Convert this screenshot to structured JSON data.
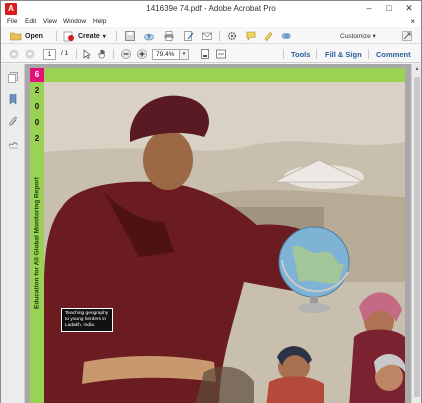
{
  "window": {
    "title": "141639e 74.pdf - Adobe Acrobat Pro",
    "app_icon_letter": "A",
    "controls": {
      "minimize": "–",
      "maximize": "□",
      "close": "✕"
    }
  },
  "menubar": {
    "items": [
      "File",
      "Edit",
      "View",
      "Window",
      "Help"
    ],
    "close_glyph": "×"
  },
  "toolbar": {
    "open_label": "Open",
    "create_label": "Create",
    "create_arrow": "▾",
    "customize_label": "Customize",
    "customize_arrow": "▾"
  },
  "navbar": {
    "current_page": "1",
    "page_total": "/ 1",
    "zoom": "79.4%",
    "zoom_arrow": "▾",
    "tools_label": "Tools",
    "fill_sign_label": "Fill & Sign",
    "comment_label": "Comment"
  },
  "document": {
    "badge_number": "6",
    "year_digits": [
      "2",
      "0",
      "0",
      "2"
    ],
    "side_title": "Education for All Global Monitoring Report",
    "caption": "Teaching geography to young herders in Ladakh, India."
  },
  "scrollbar": {
    "up_arrow": "▲"
  },
  "colors": {
    "accent_green": "#9ad353",
    "badge_magenta": "#e2117c",
    "link_blue": "#2a5d9f",
    "acrobat_red": "#d61e1e"
  }
}
